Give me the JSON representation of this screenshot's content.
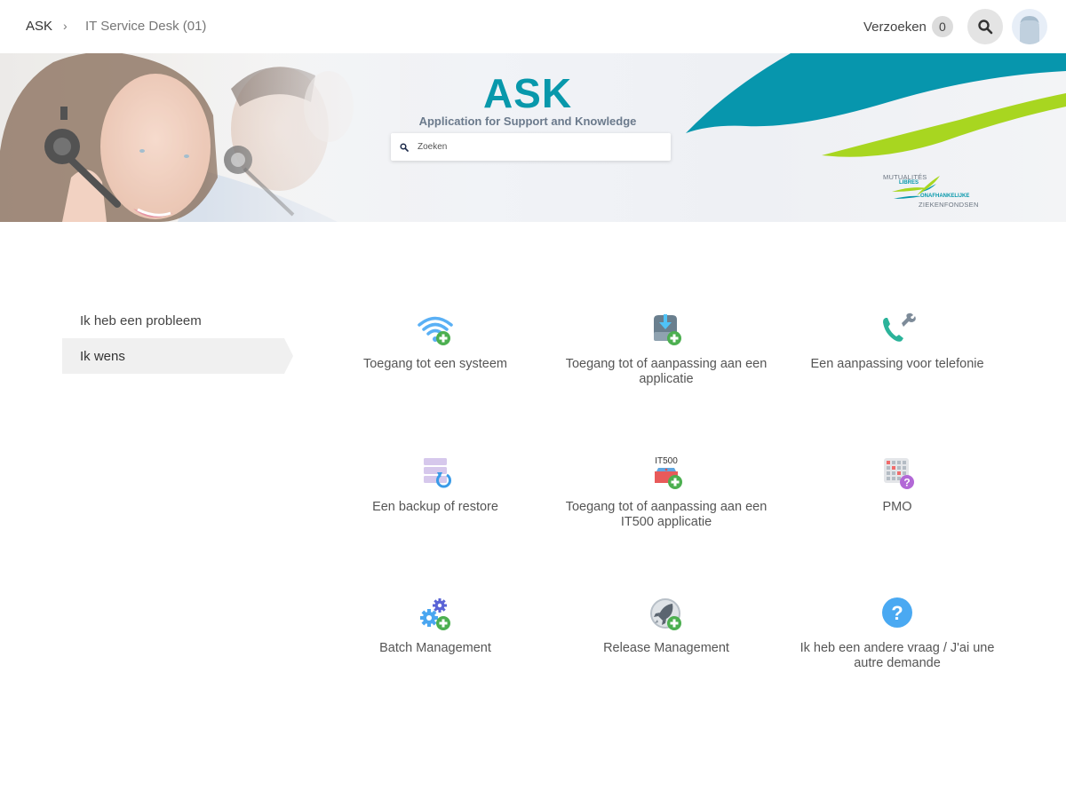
{
  "header": {
    "breadcrumb": {
      "root": "ASK",
      "separator": "›",
      "current": "IT Service Desk (01)"
    },
    "requests": {
      "label": "Verzoeken",
      "count": "0"
    },
    "search_button_icon": "search-icon",
    "avatar_icon": "user-avatar-icon"
  },
  "banner": {
    "title": "ASK",
    "subtitle": "Application for Support and Knowledge",
    "search": {
      "placeholder": "Zoeken",
      "value": ""
    },
    "org_logo": {
      "line1": "MUTUALITÉS",
      "line2": "LIBRES",
      "line3": "ONAFHANKELIJKE",
      "line4": "ZIEKENFONDSEN"
    },
    "colors": {
      "brand_teal": "#0898ab",
      "brand_green": "#a8d620"
    }
  },
  "sidebar": {
    "items": [
      {
        "label": "Ik heb een probleem",
        "active": false
      },
      {
        "label": "Ik wens",
        "active": true
      }
    ]
  },
  "catalog": {
    "items": [
      {
        "label": "Toegang tot een systeem",
        "icon": "wifi-add-icon"
      },
      {
        "label": "Toegang tot of aanpassing aan een applicatie",
        "icon": "download-drive-add-icon"
      },
      {
        "label": "Een aanpassing voor telefonie",
        "icon": "phone-wrench-icon"
      },
      {
        "label": "Een backup of restore",
        "icon": "database-restore-icon"
      },
      {
        "label": "Toegang tot of aanpassing aan een IT500 applicatie",
        "icon": "it500-box-add-icon",
        "icon_text": "IT500"
      },
      {
        "label": "PMO",
        "icon": "calendar-question-icon"
      },
      {
        "label": "Batch Management",
        "icon": "gears-add-icon"
      },
      {
        "label": "Release Management",
        "icon": "rocket-add-icon"
      },
      {
        "label": "Ik heb een andere vraag / J'ai une autre demande",
        "icon": "question-icon"
      }
    ]
  }
}
